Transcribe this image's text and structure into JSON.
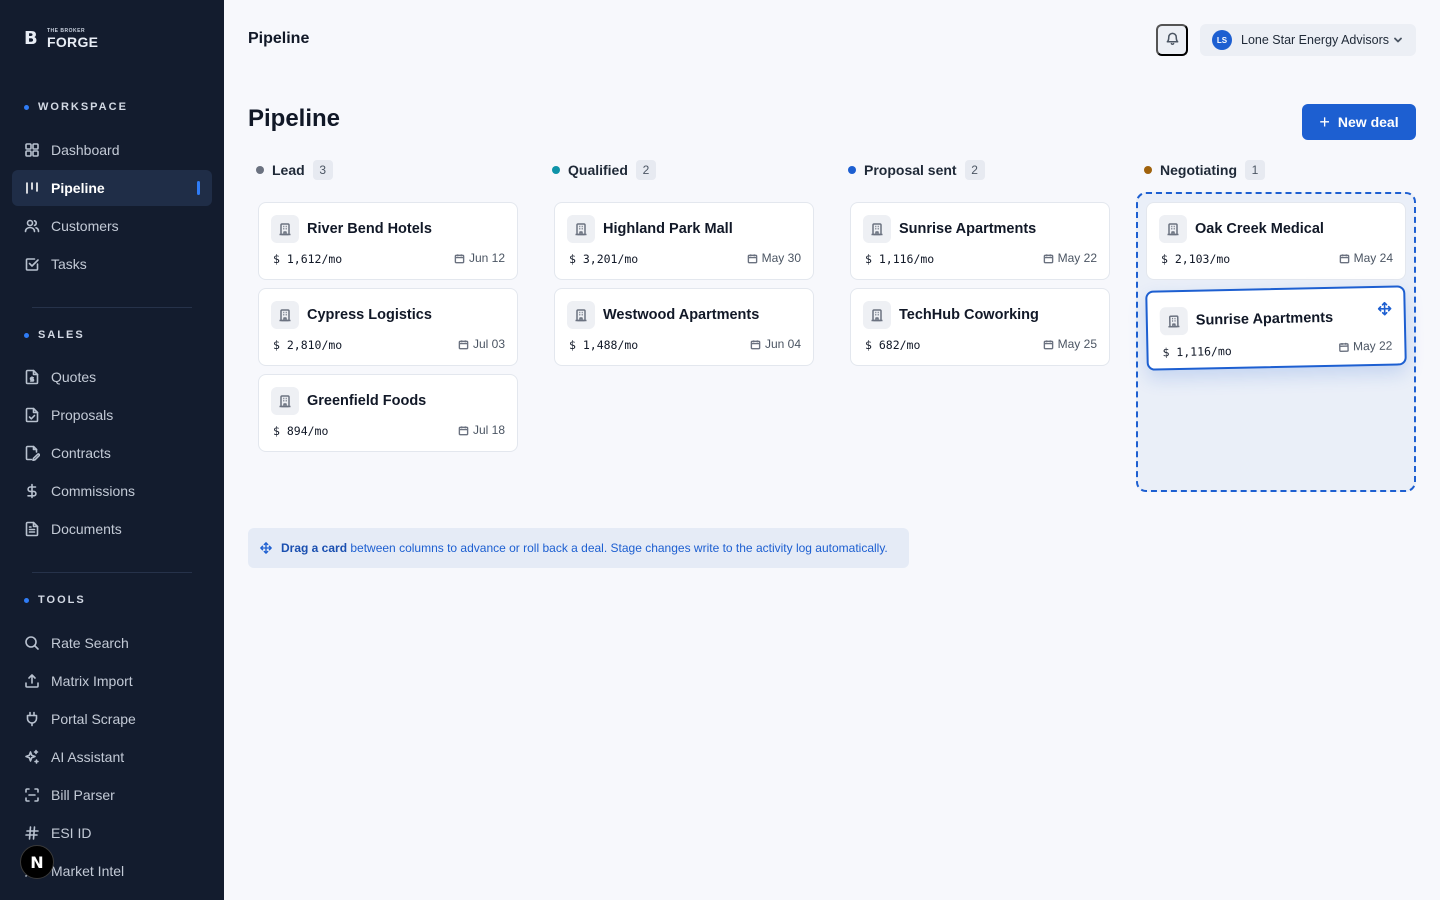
{
  "brand": {
    "small": "THE BROKER",
    "big": "FORGE",
    "mark": "B"
  },
  "sidebar": {
    "sections": [
      {
        "label": "WORKSPACE",
        "items": [
          {
            "label": "Dashboard",
            "icon": "grid-icon"
          },
          {
            "label": "Pipeline",
            "icon": "pipeline-icon",
            "active": true
          },
          {
            "label": "Customers",
            "icon": "users-icon"
          },
          {
            "label": "Tasks",
            "icon": "checkbox-icon"
          }
        ]
      },
      {
        "label": "SALES",
        "items": [
          {
            "label": "Quotes",
            "icon": "file-dollar-icon"
          },
          {
            "label": "Proposals",
            "icon": "file-check-icon"
          },
          {
            "label": "Contracts",
            "icon": "file-sign-icon"
          },
          {
            "label": "Commissions",
            "icon": "dollar-icon"
          },
          {
            "label": "Documents",
            "icon": "document-icon"
          }
        ]
      },
      {
        "label": "TOOLS",
        "items": [
          {
            "label": "Rate Search",
            "icon": "search-icon"
          },
          {
            "label": "Matrix Import",
            "icon": "upload-icon"
          },
          {
            "label": "Portal Scrape",
            "icon": "plug-icon"
          },
          {
            "label": "AI Assistant",
            "icon": "sparkles-icon"
          },
          {
            "label": "Bill Parser",
            "icon": "scan-icon"
          },
          {
            "label": "ESI ID",
            "icon": "hash-icon"
          },
          {
            "label": "Market Intel",
            "icon": "chart-icon"
          }
        ]
      }
    ],
    "dev_badge": "N"
  },
  "header": {
    "title": "Pipeline",
    "account": {
      "initials": "LS",
      "name": "Lone Star Energy Advisors"
    }
  },
  "page": {
    "title": "Pipeline",
    "new_deal_label": "New deal",
    "hint_bold": "Drag a card",
    "hint_rest": " between columns to advance or roll back a deal. Stage changes write to the activity log automatically."
  },
  "columns": [
    {
      "name": "Lead",
      "count": "3",
      "color": "#6b7280",
      "cards": [
        {
          "name": "River Bend Hotels",
          "value": "$1,612/mo",
          "date": "Jun 12"
        },
        {
          "name": "Cypress Logistics",
          "value": "$2,810/mo",
          "date": "Jul 03"
        },
        {
          "name": "Greenfield Foods",
          "value": "$894/mo",
          "date": "Jul 18"
        }
      ]
    },
    {
      "name": "Qualified",
      "count": "2",
      "color": "#0e93a8",
      "cards": [
        {
          "name": "Highland Park Mall",
          "value": "$3,201/mo",
          "date": "May 30"
        },
        {
          "name": "Westwood Apartments",
          "value": "$1,488/mo",
          "date": "Jun 04"
        }
      ]
    },
    {
      "name": "Proposal sent",
      "count": "2",
      "color": "#1d5fd1",
      "cards": [
        {
          "name": "Sunrise Apartments",
          "value": "$1,116/mo",
          "date": "May 22"
        },
        {
          "name": "TechHub Coworking",
          "value": "$682/mo",
          "date": "May 25"
        }
      ]
    },
    {
      "name": "Negotiating",
      "count": "1",
      "color": "#a0620c",
      "cards": [
        {
          "name": "Oak Creek Medical",
          "value": "$2,103/mo",
          "date": "May 24"
        }
      ]
    }
  ],
  "dragging_card": {
    "name": "Sunrise Apartments",
    "value": "1,116/mo",
    "date": "May 22"
  }
}
